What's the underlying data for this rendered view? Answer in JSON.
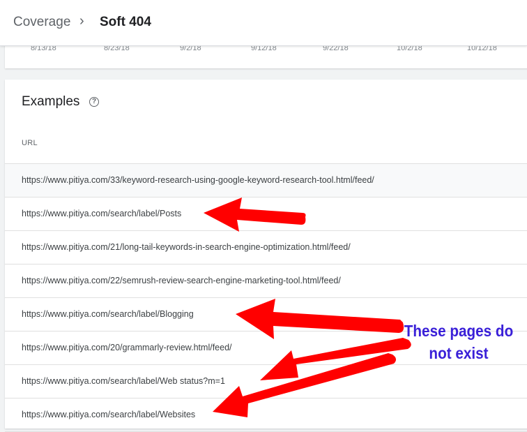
{
  "breadcrumb": {
    "parent": "Coverage",
    "separator": "›",
    "current": "Soft 404"
  },
  "chart": {
    "x_ticks": [
      "8/13/18",
      "8/23/18",
      "9/2/18",
      "9/12/18",
      "9/22/18",
      "10/2/18",
      "10/12/18"
    ]
  },
  "examples": {
    "title": "Examples",
    "help_icon_glyph": "?",
    "column_header": "URL",
    "rows": [
      "https://www.pitiya.com/33/keyword-research-using-google-keyword-research-tool.html/feed/",
      "https://www.pitiya.com/search/label/Posts",
      "https://www.pitiya.com/21/long-tail-keywords-in-search-engine-optimization.html/feed/",
      "https://www.pitiya.com/22/semrush-review-search-engine-marketing-tool.html/feed/",
      "https://www.pitiya.com/search/label/Blogging",
      "https://www.pitiya.com/20/grammarly-review.html/feed/",
      "https://www.pitiya.com/search/label/Web status?m=1",
      "https://www.pitiya.com/search/label/Websites"
    ]
  },
  "annotation": {
    "line1": "These pages do",
    "line2": "not exist",
    "text_color": "#3a20d8",
    "arrow_color": "#ff0000"
  }
}
